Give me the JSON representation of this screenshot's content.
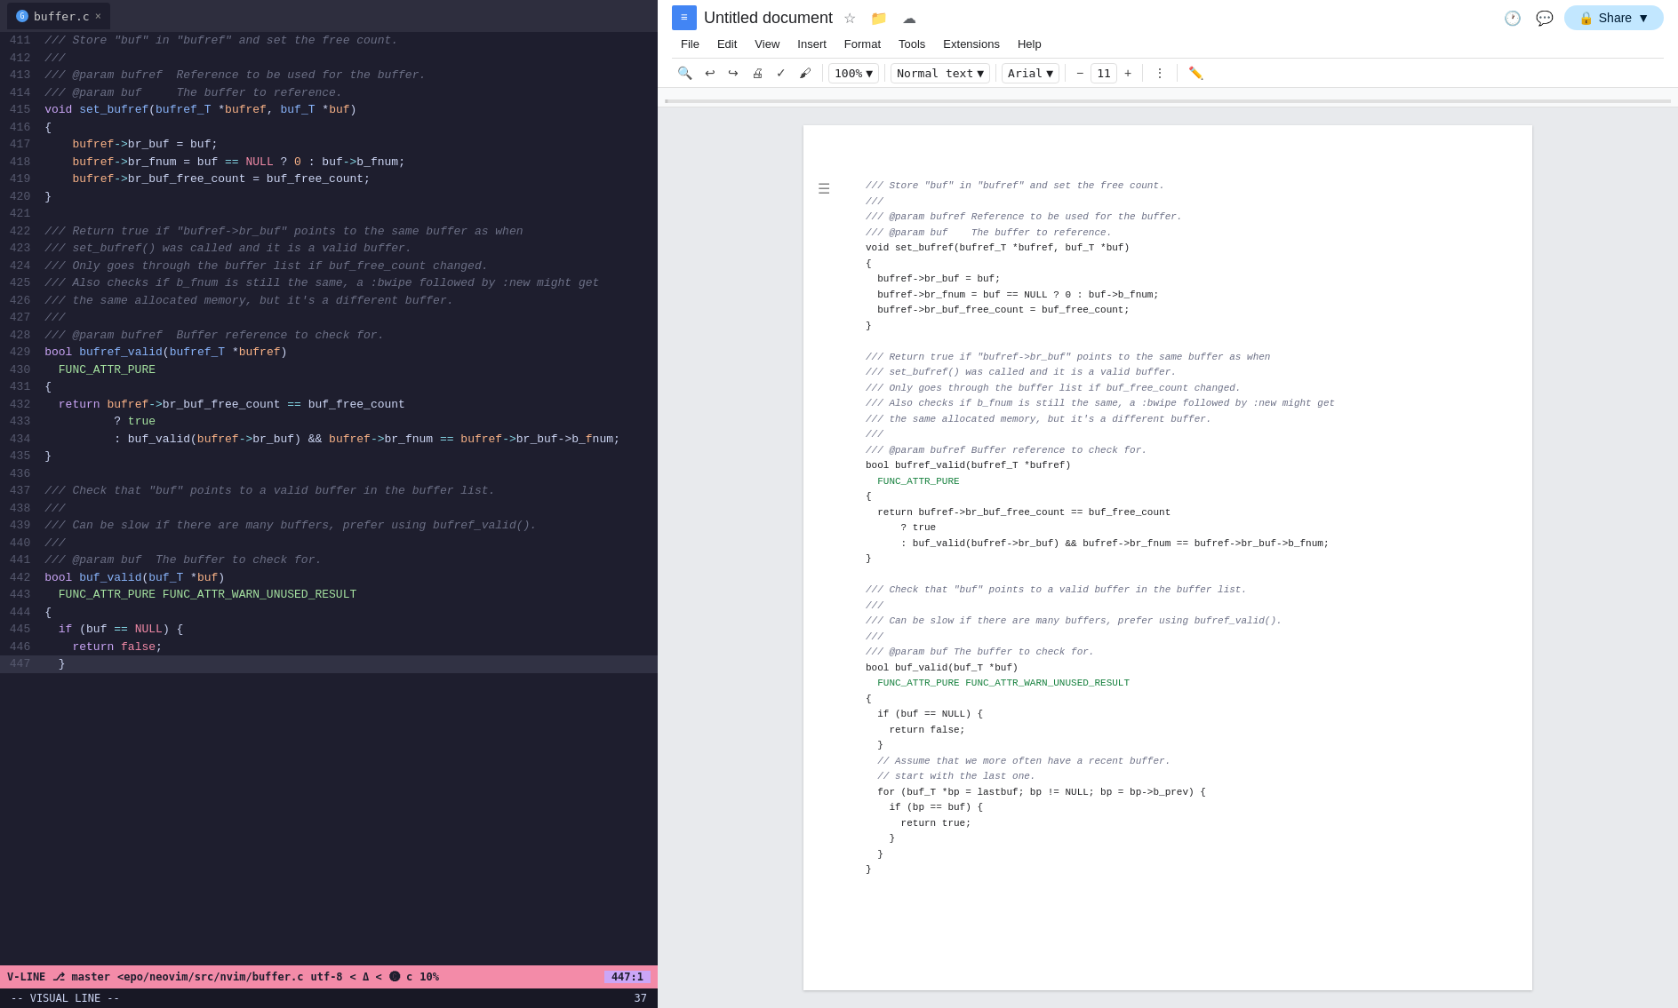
{
  "editor": {
    "tab": {
      "filename": "buffer.c",
      "favicon": "G",
      "close": "×"
    },
    "lines": [
      {
        "num": "411",
        "tokens": [
          {
            "t": "comment",
            "v": "/// Store \"buf\" in \"bufref\" and set the free count."
          }
        ]
      },
      {
        "num": "412",
        "tokens": [
          {
            "t": "comment",
            "v": "///"
          }
        ]
      },
      {
        "num": "413",
        "tokens": [
          {
            "t": "comment",
            "v": "/// @param bufref  Reference to be used for the buffer."
          }
        ]
      },
      {
        "num": "414",
        "tokens": [
          {
            "t": "comment",
            "v": "/// @param buf     The buffer to reference."
          }
        ]
      },
      {
        "num": "415",
        "tokens": [
          {
            "t": "keyword",
            "v": "void"
          },
          {
            "t": "plain",
            "v": " "
          },
          {
            "t": "func",
            "v": "set_bufref"
          },
          {
            "t": "plain",
            "v": "("
          },
          {
            "t": "type",
            "v": "bufref_T"
          },
          {
            "t": "plain",
            "v": " *"
          },
          {
            "t": "param",
            "v": "bufref"
          },
          {
            "t": "plain",
            "v": ", "
          },
          {
            "t": "type",
            "v": "buf_T"
          },
          {
            "t": "plain",
            "v": " *"
          },
          {
            "t": "param",
            "v": "buf"
          },
          {
            "t": "plain",
            "v": ")"
          }
        ]
      },
      {
        "num": "416",
        "tokens": [
          {
            "t": "plain",
            "v": "{"
          }
        ]
      },
      {
        "num": "417",
        "tokens": [
          {
            "t": "plain",
            "v": "    "
          },
          {
            "t": "param",
            "v": "bufref"
          },
          {
            "t": "arrow",
            "v": "->"
          },
          {
            "t": "plain",
            "v": "br_buf = buf;"
          }
        ]
      },
      {
        "num": "418",
        "tokens": [
          {
            "t": "plain",
            "v": "    "
          },
          {
            "t": "param",
            "v": "bufref"
          },
          {
            "t": "arrow",
            "v": "->"
          },
          {
            "t": "plain",
            "v": "br_fnum = buf "
          },
          {
            "t": "operator",
            "v": "=="
          },
          {
            "t": "plain",
            "v": " "
          },
          {
            "t": "null",
            "v": "NULL"
          },
          {
            "t": "plain",
            "v": " ? "
          },
          {
            "t": "number",
            "v": "0"
          },
          {
            "t": "plain",
            "v": " : buf"
          },
          {
            "t": "arrow",
            "v": "->"
          },
          {
            "t": "plain",
            "v": "b_fnum;"
          }
        ]
      },
      {
        "num": "419",
        "tokens": [
          {
            "t": "plain",
            "v": "    "
          },
          {
            "t": "param",
            "v": "bufref"
          },
          {
            "t": "arrow",
            "v": "->"
          },
          {
            "t": "plain",
            "v": "br_buf_free_count = buf_free_count;"
          }
        ]
      },
      {
        "num": "420",
        "tokens": [
          {
            "t": "plain",
            "v": "}"
          }
        ]
      },
      {
        "num": "421",
        "tokens": [
          {
            "t": "plain",
            "v": ""
          }
        ]
      },
      {
        "num": "422",
        "tokens": [
          {
            "t": "comment",
            "v": "/// Return true if \"bufref->br_buf\" points to the same buffer as when"
          }
        ]
      },
      {
        "num": "423",
        "tokens": [
          {
            "t": "comment",
            "v": "/// set_bufref() was called and it is a valid buffer."
          }
        ]
      },
      {
        "num": "424",
        "tokens": [
          {
            "t": "comment",
            "v": "/// Only goes through the buffer list if buf_free_count changed."
          }
        ]
      },
      {
        "num": "425",
        "tokens": [
          {
            "t": "comment",
            "v": "/// Also checks if b_fnum is still the same, a :bwipe followed by :new might get"
          }
        ]
      },
      {
        "num": "426",
        "tokens": [
          {
            "t": "comment",
            "v": "/// the same allocated memory, but it's a different buffer."
          }
        ]
      },
      {
        "num": "427",
        "tokens": [
          {
            "t": "comment",
            "v": "///"
          }
        ]
      },
      {
        "num": "428",
        "tokens": [
          {
            "t": "comment",
            "v": "/// @param bufref  Buffer reference to check for."
          }
        ]
      },
      {
        "num": "429",
        "tokens": [
          {
            "t": "keyword",
            "v": "bool"
          },
          {
            "t": "plain",
            "v": " "
          },
          {
            "t": "func",
            "v": "bufref_valid"
          },
          {
            "t": "plain",
            "v": "("
          },
          {
            "t": "type",
            "v": "bufref_T"
          },
          {
            "t": "plain",
            "v": " *"
          },
          {
            "t": "param",
            "v": "bufref"
          },
          {
            "t": "plain",
            "v": ")"
          }
        ]
      },
      {
        "num": "430",
        "tokens": [
          {
            "t": "macro",
            "v": "  FUNC_ATTR_PURE"
          }
        ]
      },
      {
        "num": "431",
        "tokens": [
          {
            "t": "plain",
            "v": "{"
          }
        ]
      },
      {
        "num": "432",
        "tokens": [
          {
            "t": "plain",
            "v": "  "
          },
          {
            "t": "keyword",
            "v": "return"
          },
          {
            "t": "plain",
            "v": " "
          },
          {
            "t": "param",
            "v": "bufref"
          },
          {
            "t": "arrow",
            "v": "->"
          },
          {
            "t": "plain",
            "v": "br_buf_free_count "
          },
          {
            "t": "operator",
            "v": "=="
          },
          {
            "t": "plain",
            "v": " buf_free_count"
          }
        ]
      },
      {
        "num": "433",
        "tokens": [
          {
            "t": "plain",
            "v": "          ? "
          },
          {
            "t": "true",
            "v": "true"
          }
        ]
      },
      {
        "num": "434",
        "tokens": [
          {
            "t": "plain",
            "v": "          : buf_valid("
          },
          {
            "t": "param",
            "v": "bufref"
          },
          {
            "t": "arrow",
            "v": "->"
          },
          {
            "t": "plain",
            "v": "br_buf) && "
          },
          {
            "t": "param",
            "v": "bufref"
          },
          {
            "t": "arrow",
            "v": "->"
          },
          {
            "t": "plain",
            "v": "br_fnum "
          },
          {
            "t": "operator",
            "v": "=="
          },
          {
            "t": "plain",
            "v": " "
          },
          {
            "t": "param",
            "v": "bufref"
          },
          {
            "t": "arrow",
            "v": "->"
          },
          {
            "t": "plain",
            "v": "br_buf->b_"
          },
          {
            "t": "param",
            "v": "f"
          },
          {
            "t": "plain",
            "v": "num;"
          }
        ]
      },
      {
        "num": "435",
        "tokens": [
          {
            "t": "plain",
            "v": "}"
          }
        ]
      },
      {
        "num": "436",
        "tokens": [
          {
            "t": "plain",
            "v": ""
          }
        ]
      },
      {
        "num": "437",
        "tokens": [
          {
            "t": "comment",
            "v": "/// Check that \"buf\" points to a valid buffer in the buffer list."
          }
        ]
      },
      {
        "num": "438",
        "tokens": [
          {
            "t": "comment",
            "v": "///"
          }
        ]
      },
      {
        "num": "439",
        "tokens": [
          {
            "t": "comment",
            "v": "/// Can be slow if there are many buffers, prefer using bufref_valid()."
          }
        ]
      },
      {
        "num": "440",
        "tokens": [
          {
            "t": "comment",
            "v": "///"
          }
        ]
      },
      {
        "num": "441",
        "tokens": [
          {
            "t": "comment",
            "v": "/// @param buf  The buffer to check for."
          }
        ]
      },
      {
        "num": "442",
        "tokens": [
          {
            "t": "keyword",
            "v": "bool"
          },
          {
            "t": "plain",
            "v": " "
          },
          {
            "t": "func",
            "v": "buf_valid"
          },
          {
            "t": "plain",
            "v": "("
          },
          {
            "t": "type",
            "v": "buf_T"
          },
          {
            "t": "plain",
            "v": " *"
          },
          {
            "t": "param",
            "v": "buf"
          },
          {
            "t": "plain",
            "v": ")"
          }
        ]
      },
      {
        "num": "443",
        "tokens": [
          {
            "t": "macro",
            "v": "  FUNC_ATTR_PURE FUNC_ATTR_WARN_UNUSED_RESULT"
          }
        ]
      },
      {
        "num": "444",
        "tokens": [
          {
            "t": "plain",
            "v": "{"
          }
        ]
      },
      {
        "num": "445",
        "tokens": [
          {
            "t": "plain",
            "v": "  "
          },
          {
            "t": "keyword",
            "v": "if"
          },
          {
            "t": "plain",
            "v": " (buf "
          },
          {
            "t": "operator",
            "v": "=="
          },
          {
            "t": "plain",
            "v": " "
          },
          {
            "t": "null",
            "v": "NULL"
          },
          {
            "t": "plain",
            "v": ") {"
          }
        ]
      },
      {
        "num": "446",
        "tokens": [
          {
            "t": "plain",
            "v": "    "
          },
          {
            "t": "keyword",
            "v": "return"
          },
          {
            "t": "plain",
            "v": " "
          },
          {
            "t": "false",
            "v": "false"
          },
          {
            "t": "plain",
            "v": ";"
          }
        ]
      },
      {
        "num": "447",
        "tokens": [
          {
            "t": "plain",
            "v": "  }"
          }
        ],
        "highlight": true
      }
    ],
    "statusBar": {
      "mode": "V-LINE",
      "git": "master",
      "file": "<epo/neovim/src/nvim/buffer.c",
      "encoding": "utf-8",
      "indicators": "< Δ <",
      "filetype": "c",
      "percent": "10%",
      "position": "447:1"
    },
    "visualLine": "-- VISUAL LINE --",
    "lineCount": "37"
  },
  "gdocs": {
    "title": "Untitled document",
    "starred": "☆",
    "share": "Share",
    "menu": [
      "File",
      "Edit",
      "View",
      "Insert",
      "Format",
      "Tools",
      "Extensions",
      "Help"
    ],
    "toolbar": {
      "zoom": "100%",
      "style": "Normal text",
      "font": "Arial",
      "fontSize": "11"
    },
    "content": {
      "lines": [
        "/// Store \"buf\" in \"bufref\" and set the free count.",
        "///",
        "/// @param bufref Reference to be used for the buffer.",
        "/// @param buf    The buffer to reference.",
        "void set_bufref(bufref_T *bufref, buf_T *buf)",
        "{",
        "  bufref->br_buf = buf;",
        "  bufref->br_fnum = buf == NULL ? 0 : buf->b_fnum;",
        "  bufref->br_buf_free_count = buf_free_count;",
        "}",
        "",
        "/// Return true if \"bufref->br_buf\" points to the same buffer as when",
        "/// set_bufref() was called and it is a valid buffer.",
        "/// Only goes through the buffer list if buf_free_count changed.",
        "/// Also checks if b_fnum is still the same, a :bwipe followed by :new might get",
        "/// the same allocated memory, but it's a different buffer.",
        "///",
        "/// @param bufref Buffer reference to check for.",
        "bool bufref_valid(bufref_T *bufref)",
        "  FUNC_ATTR_PURE",
        "{",
        "  return bufref->br_buf_free_count == buf_free_count",
        "      ? true",
        "      : buf_valid(bufref->br_buf) && bufref->br_fnum == bufref->br_buf->b_fnum;",
        "}",
        "",
        "/// Check that \"buf\" points to a valid buffer in the buffer list.",
        "///",
        "/// Can be slow if there are many buffers, prefer using bufref_valid().",
        "///",
        "/// @param buf The buffer to check for.",
        "bool buf_valid(buf_T *buf)",
        "  FUNC_ATTR_PURE FUNC_ATTR_WARN_UNUSED_RESULT",
        "{",
        "  if (buf == NULL) {",
        "    return false;",
        "  }",
        "  // Assume that we more often have a recent buffer.",
        "  // start with the last one.",
        "  for (buf_T *bp = lastbuf; bp != NULL; bp = bp->b_prev) {",
        "    if (bp == buf) {",
        "      return true;",
        "    }",
        "  }",
        "}"
      ]
    }
  }
}
